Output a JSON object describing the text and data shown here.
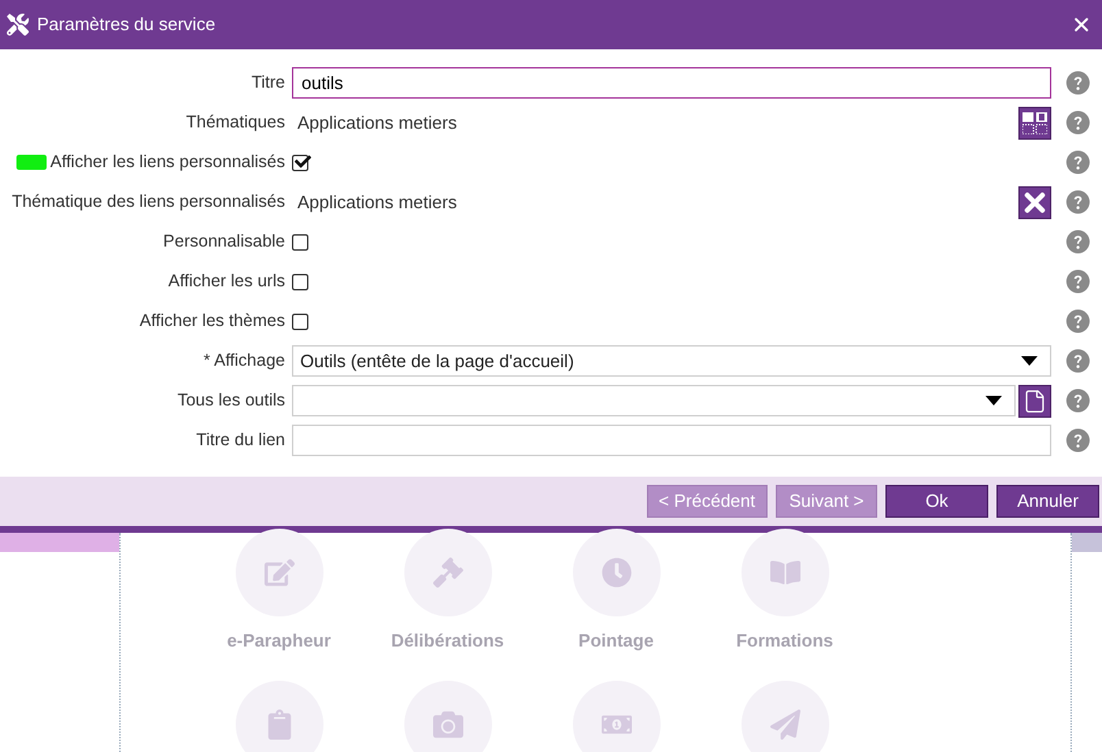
{
  "dialog": {
    "title": "Paramètres du service",
    "fields": [
      {
        "kind": "text",
        "label": "Titre",
        "value": "outils",
        "focused": true
      },
      {
        "kind": "display",
        "label": "Thématiques",
        "value": "Applications metiers",
        "action": {
          "kind": "grid"
        }
      },
      {
        "kind": "checkbox",
        "label": "Afficher les liens personnalisés",
        "checked": true,
        "highlighted": true
      },
      {
        "kind": "display",
        "label": "Thématique des liens personnalisés",
        "value": "Applications metiers",
        "action": {
          "kind": "clear"
        }
      },
      {
        "kind": "checkbox",
        "label": "Personnalisable",
        "checked": false
      },
      {
        "kind": "checkbox",
        "label": "Afficher les urls",
        "checked": false
      },
      {
        "kind": "checkbox",
        "label": "Afficher les thèmes",
        "checked": false
      },
      {
        "kind": "select",
        "label": "* Affichage",
        "value": "Outils (entête de la page d'accueil)"
      },
      {
        "kind": "select",
        "label": "Tous les outils",
        "action": {
          "kind": "file"
        }
      },
      {
        "kind": "text",
        "label": "Titre du lien",
        "focused": false
      }
    ],
    "buttons": [
      {
        "label": "< Précédent",
        "disabled": true
      },
      {
        "label": "Suivant >",
        "disabled": true
      },
      {
        "label": "Ok",
        "disabled": false
      },
      {
        "label": "Annuler",
        "disabled": false
      }
    ]
  },
  "background_tiles": [
    {
      "kind": "tile",
      "label": "e-Parapheur"
    },
    {
      "kind": "tile",
      "label": "Délibérations"
    },
    {
      "kind": "tile",
      "label": "Pointage"
    },
    {
      "kind": "tile",
      "label": "Formations"
    },
    {
      "kind": "tile"
    },
    {
      "kind": "tile"
    },
    {
      "kind": "tile"
    },
    {
      "kind": "tile"
    }
  ]
}
